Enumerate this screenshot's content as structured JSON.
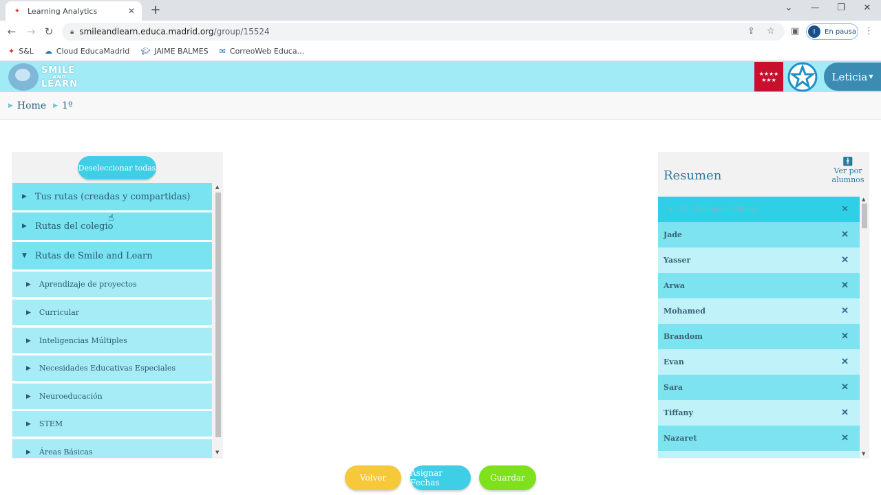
{
  "browser": {
    "tab_title": "Learning Analytics",
    "url_host": "smileandlearn.educa.madrid.org",
    "url_path": "/group/15524",
    "profile_initial": "I",
    "profile_label": "En pausa",
    "bookmarks": [
      {
        "label": "S&L",
        "icon": "sl-favicon"
      },
      {
        "label": "Cloud EducaMadrid",
        "icon": "cloud-icon"
      },
      {
        "label": "JAIME BALMES",
        "icon": "graduation-cap-icon"
      },
      {
        "label": "CorreoWeb Educa...",
        "icon": "mail-icon"
      }
    ]
  },
  "header": {
    "logo_line1": "SMILE",
    "logo_line2": "AND",
    "logo_line3": "LEARN",
    "user_name": "Leticia",
    "accent": "#a0ebf6"
  },
  "breadcrumb": {
    "home": "Home",
    "current": "1º"
  },
  "left": {
    "deselect_label": "Deseleccionar todas",
    "items": [
      {
        "label": "Tus rutas (creadas y compartidas)",
        "level": "top",
        "expanded": false
      },
      {
        "label": "Rutas del colegio",
        "level": "top",
        "expanded": false
      },
      {
        "label": "Rutas de Smile and Learn",
        "level": "top",
        "expanded": true
      },
      {
        "label": "Aprendizaje de proyectos",
        "level": "sub",
        "expanded": false
      },
      {
        "label": "Curricular",
        "level": "sub",
        "expanded": false
      },
      {
        "label": "Inteligencias Múltiples",
        "level": "sub",
        "expanded": false
      },
      {
        "label": "Necesidades Educativas Especiales",
        "level": "sub",
        "expanded": false
      },
      {
        "label": "Neuroeducación",
        "level": "sub",
        "expanded": false
      },
      {
        "label": "STEM",
        "level": "sub",
        "expanded": false
      },
      {
        "label": "Áreas Básicas",
        "level": "sub",
        "expanded": false
      }
    ]
  },
  "right": {
    "title": "Resumen",
    "view_by": "Ver por alumnos",
    "group_label": "1º - Sciences 2ºterm",
    "students": [
      "Jade",
      "Yasser",
      "Arwa",
      "Mohamed",
      "Brandom",
      "Evan",
      "Sara",
      "Tiffany",
      "Nazaret"
    ]
  },
  "actions": {
    "back": "Volver",
    "assign_dates": "Asignar Fechas",
    "save": "Guardar",
    "back_color": "#f5c93a",
    "assign_color": "#3ecfe6",
    "save_color": "#7ee11c"
  }
}
